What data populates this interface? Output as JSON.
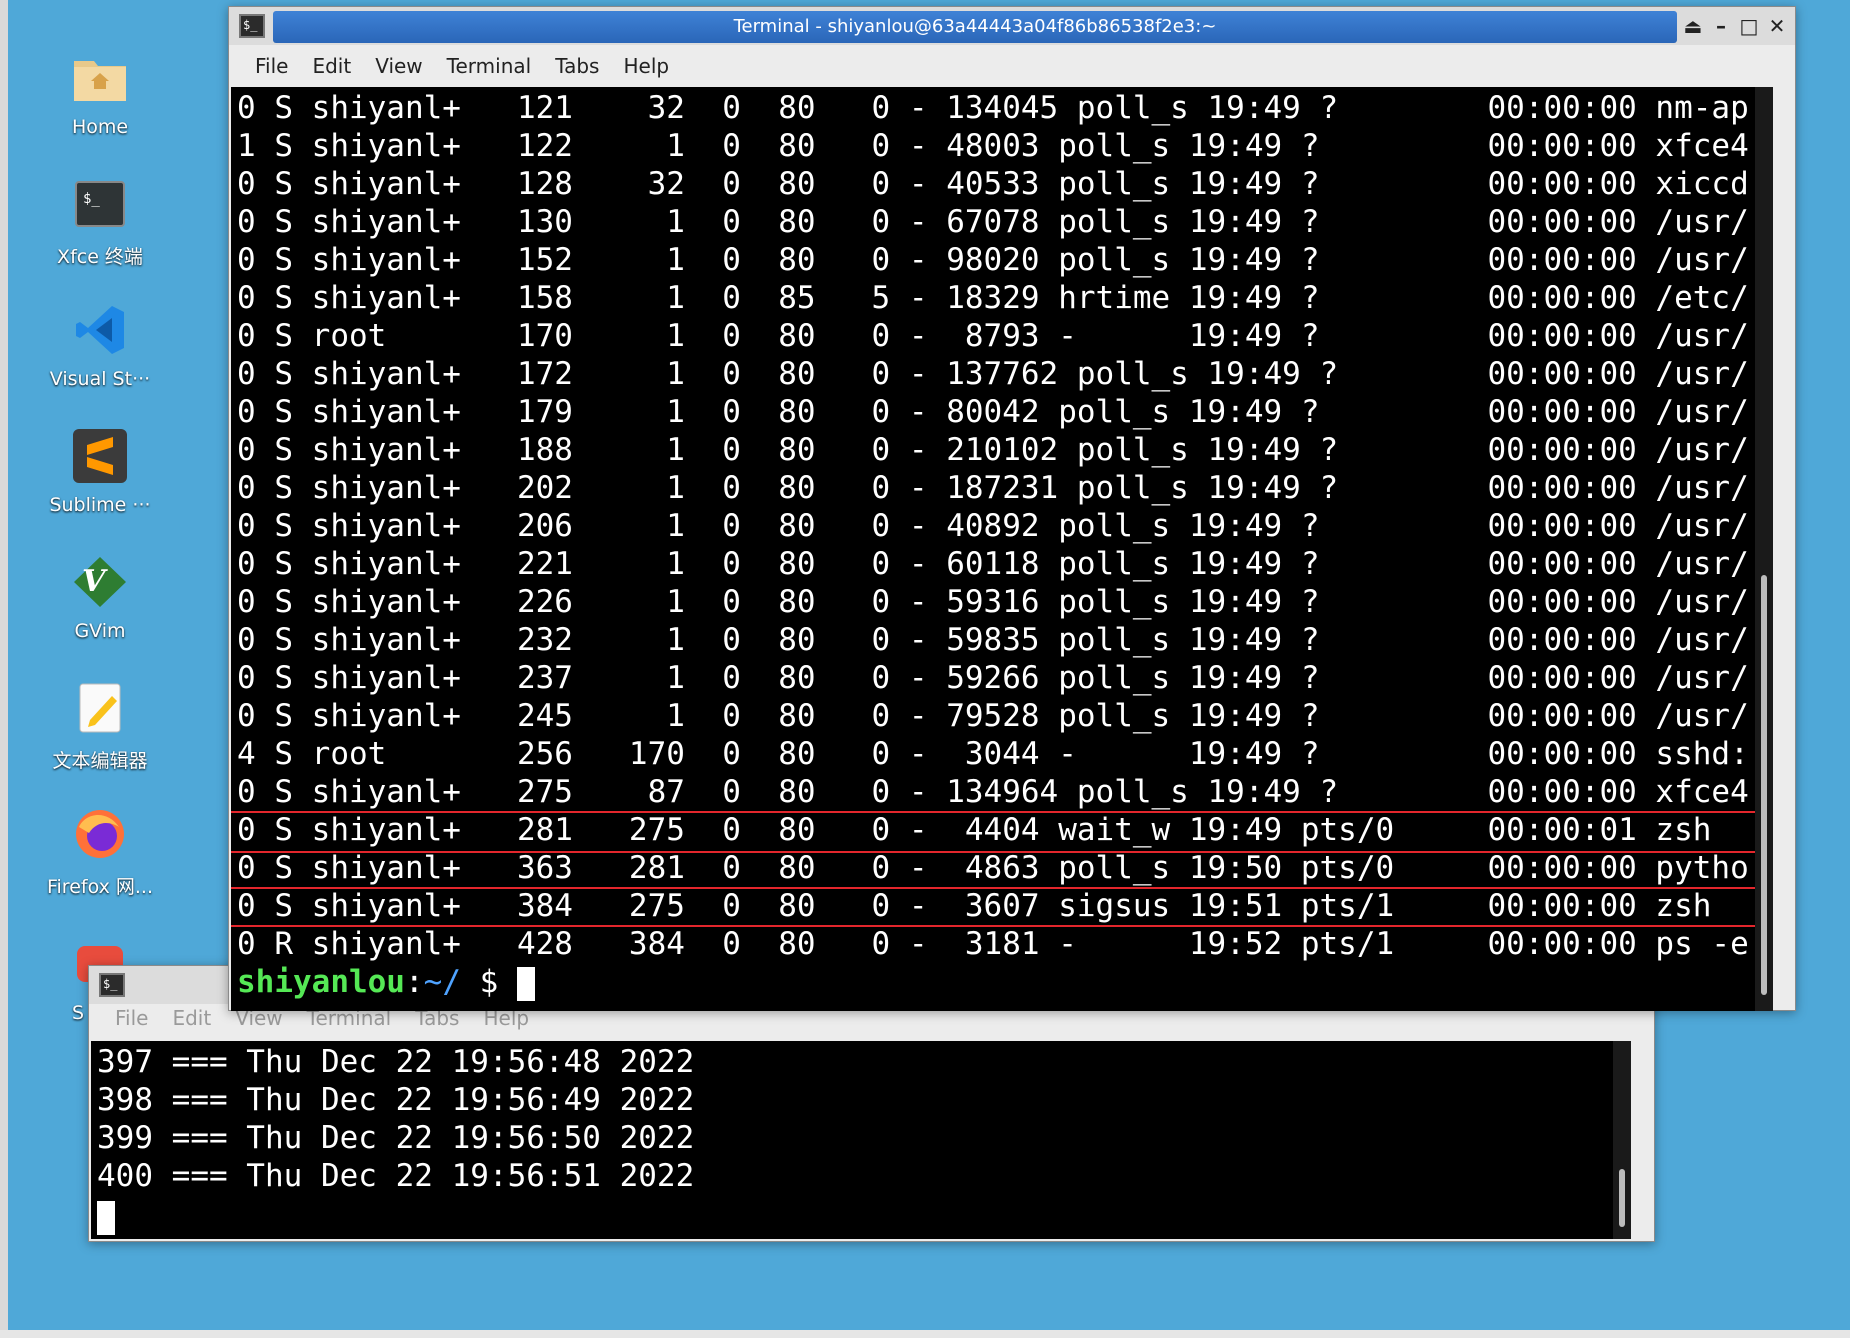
{
  "desktop": {
    "icons": [
      {
        "label": "Home",
        "icon": "home-folder-icon"
      },
      {
        "label": "Xfce 终端",
        "icon": "terminal-icon"
      },
      {
        "label": "Visual St···",
        "icon": "vscode-icon"
      },
      {
        "label": "Sublime ···",
        "icon": "sublime-icon"
      },
      {
        "label": "GVim",
        "icon": "gvim-icon"
      },
      {
        "label": "文本编辑器",
        "icon": "text-editor-icon"
      },
      {
        "label": "Firefox 网...",
        "icon": "firefox-icon"
      },
      {
        "label": "S",
        "icon": "app-icon"
      }
    ]
  },
  "windows": {
    "main": {
      "title": "Terminal - shiyanlou@63a44443a04f86b86538f2e3:~",
      "menu": [
        "File",
        "Edit",
        "View",
        "Terminal",
        "Tabs",
        "Help"
      ],
      "lines": [
        "0 S shiyanl+   121    32  0  80   0 - 134045 poll_s 19:49 ?        00:00:00 nm-ap",
        "1 S shiyanl+   122     1  0  80   0 - 48003 poll_s 19:49 ?         00:00:00 xfce4",
        "0 S shiyanl+   128    32  0  80   0 - 40533 poll_s 19:49 ?         00:00:00 xiccd",
        "0 S shiyanl+   130     1  0  80   0 - 67078 poll_s 19:49 ?         00:00:00 /usr/",
        "0 S shiyanl+   152     1  0  80   0 - 98020 poll_s 19:49 ?         00:00:00 /usr/",
        "0 S shiyanl+   158     1  0  85   5 - 18329 hrtime 19:49 ?         00:00:00 /etc/",
        "0 S root       170     1  0  80   0 -  8793 -      19:49 ?         00:00:00 /usr/",
        "0 S shiyanl+   172     1  0  80   0 - 137762 poll_s 19:49 ?        00:00:00 /usr/",
        "0 S shiyanl+   179     1  0  80   0 - 80042 poll_s 19:49 ?         00:00:00 /usr/",
        "0 S shiyanl+   188     1  0  80   0 - 210102 poll_s 19:49 ?        00:00:00 /usr/",
        "0 S shiyanl+   202     1  0  80   0 - 187231 poll_s 19:49 ?        00:00:00 /usr/",
        "0 S shiyanl+   206     1  0  80   0 - 40892 poll_s 19:49 ?         00:00:00 /usr/",
        "0 S shiyanl+   221     1  0  80   0 - 60118 poll_s 19:49 ?         00:00:00 /usr/",
        "0 S shiyanl+   226     1  0  80   0 - 59316 poll_s 19:49 ?         00:00:00 /usr/",
        "0 S shiyanl+   232     1  0  80   0 - 59835 poll_s 19:49 ?         00:00:00 /usr/",
        "0 S shiyanl+   237     1  0  80   0 - 59266 poll_s 19:49 ?         00:00:00 /usr/",
        "0 S shiyanl+   245     1  0  80   0 - 79528 poll_s 19:49 ?         00:00:00 /usr/",
        "4 S root       256   170  0  80   0 -  3044 -      19:49 ?         00:00:00 sshd:",
        "0 S shiyanl+   275    87  0  80   0 - 134964 poll_s 19:49 ?        00:00:00 xfce4",
        "0 S shiyanl+   281   275  0  80   0 -  4404 wait_w 19:49 pts/0     00:00:01 zsh",
        "0 S shiyanl+   363   281  0  80   0 -  4863 poll_s 19:50 pts/0     00:00:00 pytho",
        "0 S shiyanl+   384   275  0  80   0 -  3607 sigsus 19:51 pts/1     00:00:00 zsh",
        "0 R shiyanl+   428   384  0  80   0 -  3181 -      19:52 pts/1     00:00:00 ps -e"
      ],
      "prompt": {
        "user": "shiyanlou",
        "path": "~/",
        "symbol": "$"
      },
      "highlight_color": "#e3262c"
    },
    "second": {
      "menu": [
        "File",
        "Edit",
        "View",
        "Terminal",
        "Tabs",
        "Help"
      ],
      "lines": [
        "397 === Thu Dec 22 19:56:48 2022",
        "398 === Thu Dec 22 19:56:49 2022",
        "399 === Thu Dec 22 19:56:50 2022",
        "400 === Thu Dec 22 19:56:51 2022"
      ]
    }
  },
  "colors": {
    "desktop_bg": "#4fa8d8",
    "titlebar_active": "#2a66b8",
    "prompt_user": "#55e855",
    "prompt_path": "#4fa3ff"
  }
}
